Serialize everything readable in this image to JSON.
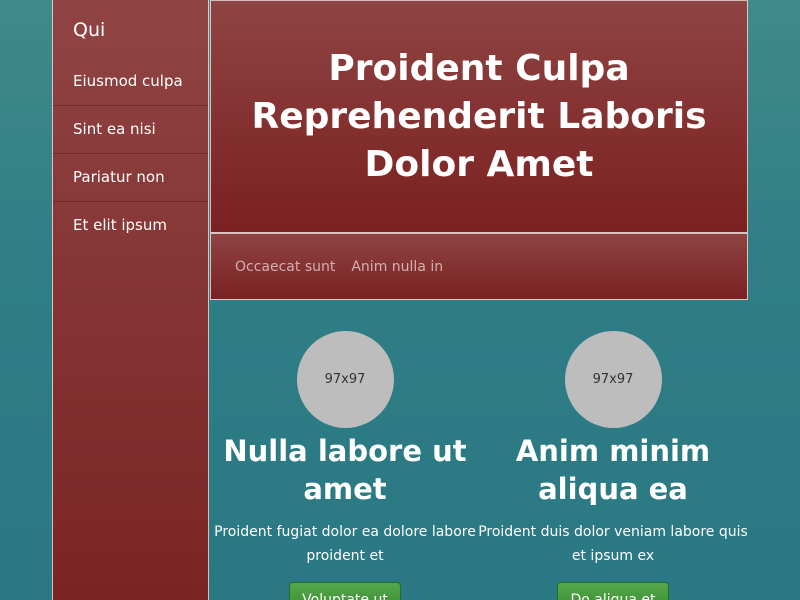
{
  "sidebar": {
    "brand": "Qui",
    "items": [
      {
        "label": "Eiusmod culpa"
      },
      {
        "label": "Sint ea nisi"
      },
      {
        "label": "Pariatur non"
      },
      {
        "label": "Et elit ipsum"
      }
    ]
  },
  "hero": {
    "title": "Proident Culpa Reprehenderit Laboris Dolor Amet"
  },
  "subnav": {
    "items": [
      {
        "label": "Occaecat sunt"
      },
      {
        "label": "Anim nulla in"
      }
    ]
  },
  "features": [
    {
      "image_label": "97x97",
      "title": "Nulla labore ut amet",
      "text": "Proident fugiat dolor ea dolore labore proident et",
      "button": "Voluptate ut"
    },
    {
      "image_label": "97x97",
      "title": "Anim minim aliqua ea",
      "text": "Proident duis dolor veniam labore quis et ipsum ex",
      "button": "Do aliqua et"
    }
  ]
}
